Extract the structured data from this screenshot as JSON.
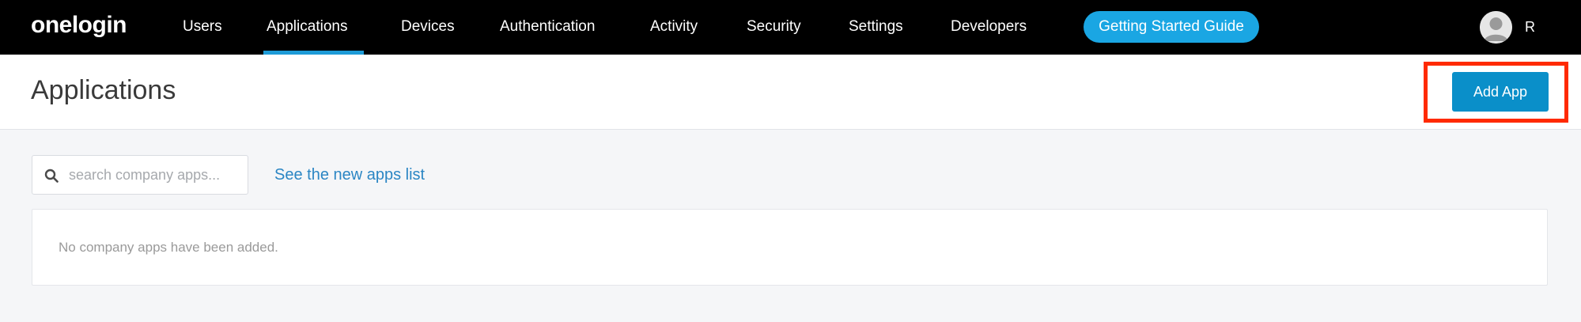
{
  "topbar": {
    "logo": "onelogin",
    "nav": [
      {
        "label": "Users"
      },
      {
        "label": "Applications",
        "active": true
      },
      {
        "label": "Devices"
      },
      {
        "label": "Authentication"
      },
      {
        "label": "Activity"
      },
      {
        "label": "Security"
      },
      {
        "label": "Settings"
      },
      {
        "label": "Developers"
      }
    ],
    "guide_button": "Getting Started Guide",
    "user_initial": "R",
    "avatar_icon": "user-avatar-icon"
  },
  "header": {
    "title": "Applications",
    "add_button": "Add App"
  },
  "search": {
    "placeholder": "search company apps...",
    "value": "",
    "icon": "search-icon"
  },
  "link": {
    "label": "See the new apps list"
  },
  "apps_list": {
    "empty_message": "No company apps have been added."
  },
  "colors": {
    "topbar_bg": "#000000",
    "accent": "#1aa6e3",
    "primary_button": "#0a8fc9",
    "highlight": "#ff2a00",
    "link": "#2b86c4"
  }
}
